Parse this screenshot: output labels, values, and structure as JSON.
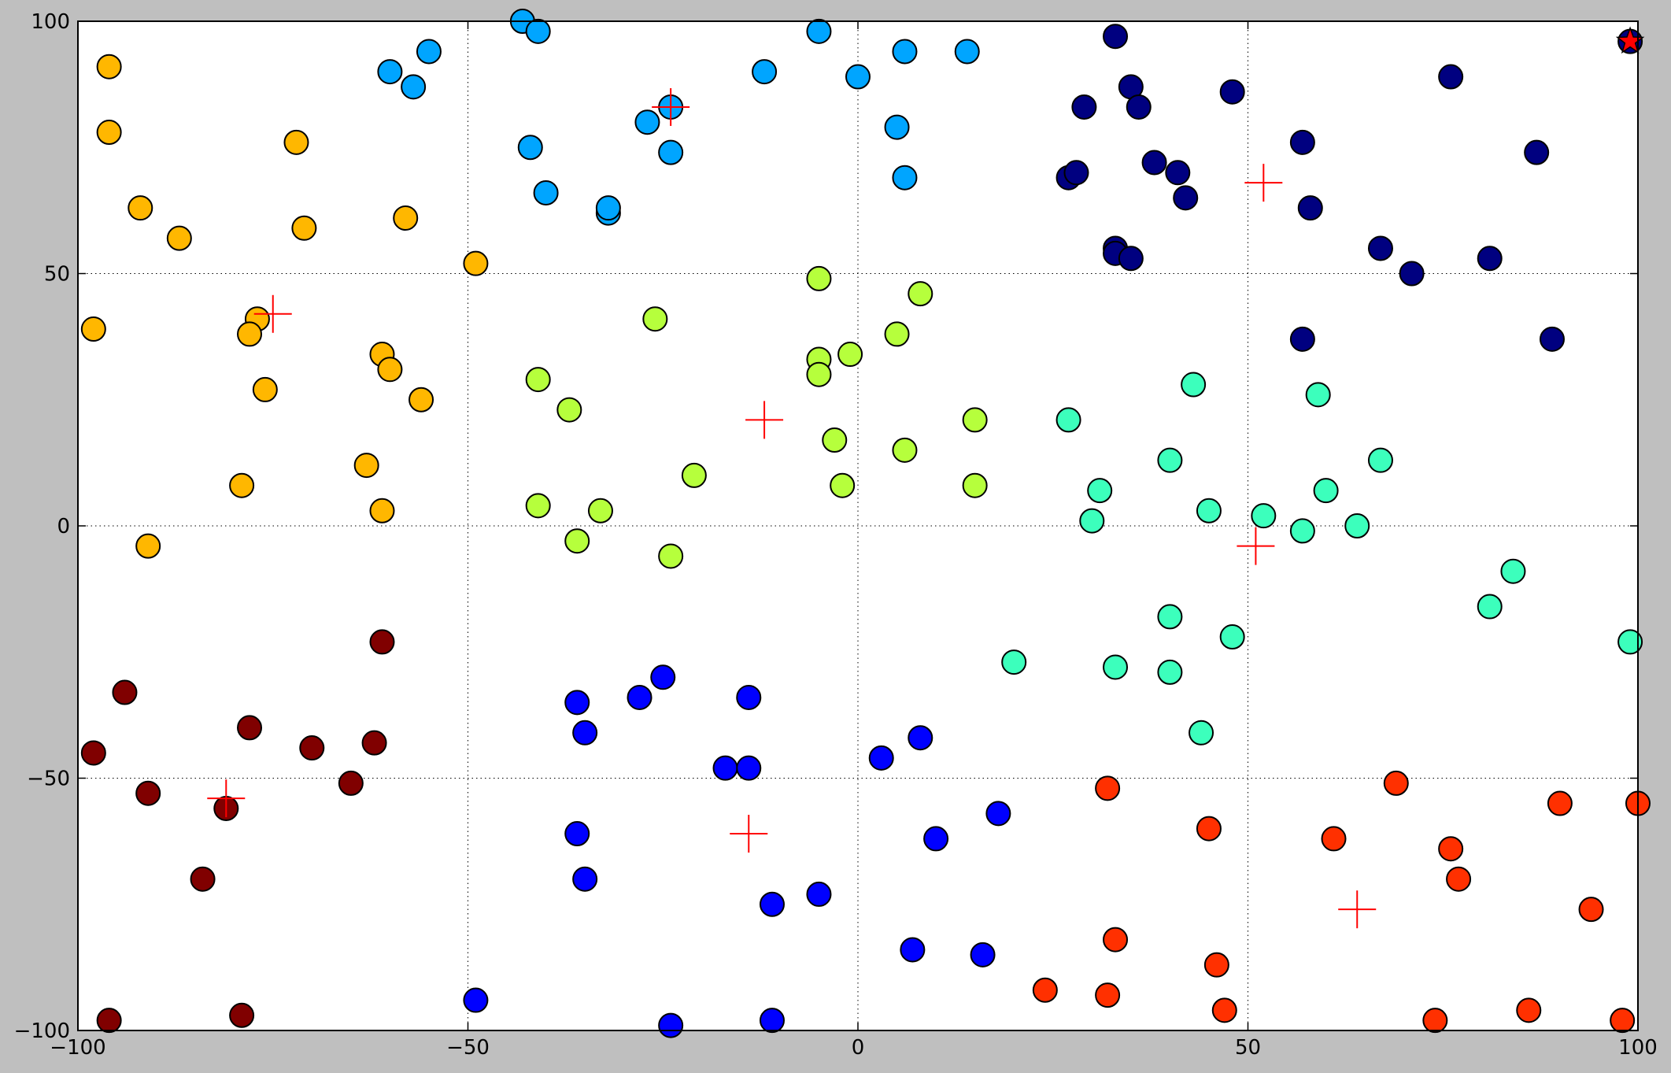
{
  "colors": {
    "figure_background": "#bfbfbf",
    "plot_background": "#ffffff",
    "marker_edge": "#000000",
    "centroid_marker": "#ff0000",
    "highlight_star": "#ff0000"
  },
  "chart_data": {
    "type": "scatter",
    "title": "",
    "xlabel": "",
    "ylabel": "",
    "xlim": [
      -100,
      100
    ],
    "ylim": [
      -100,
      100
    ],
    "xticks": [
      -100,
      -50,
      0,
      50,
      100
    ],
    "yticks": [
      -100,
      -50,
      0,
      50,
      100
    ],
    "grid": true,
    "grid_style": "dotted",
    "legend": "none",
    "colormap": "jet",
    "centroid_marker": "plus",
    "series": [
      {
        "color": "#000080",
        "points": [
          [
            33,
            97
          ],
          [
            76,
            89
          ],
          [
            48,
            86
          ],
          [
            29,
            83
          ],
          [
            35,
            87
          ],
          [
            36,
            83
          ],
          [
            57,
            76
          ],
          [
            87,
            74
          ],
          [
            38,
            72
          ],
          [
            41,
            70
          ],
          [
            27,
            69
          ],
          [
            28,
            70
          ],
          [
            42,
            65
          ],
          [
            58,
            63
          ],
          [
            33,
            55
          ],
          [
            33,
            54
          ],
          [
            35,
            53
          ],
          [
            67,
            55
          ],
          [
            71,
            50
          ],
          [
            81,
            53
          ],
          [
            89,
            37
          ],
          [
            57,
            37
          ]
        ]
      },
      {
        "color": "#0000ff",
        "points": [
          [
            -36,
            -35
          ],
          [
            -28,
            -34
          ],
          [
            -25,
            -30
          ],
          [
            -14,
            -34
          ],
          [
            -35,
            -41
          ],
          [
            -17,
            -48
          ],
          [
            -14,
            -48
          ],
          [
            3,
            -46
          ],
          [
            8,
            -42
          ],
          [
            18,
            -57
          ],
          [
            -36,
            -61
          ],
          [
            -35,
            -70
          ],
          [
            10,
            -62
          ],
          [
            -11,
            -75
          ],
          [
            -5,
            -73
          ],
          [
            7,
            -84
          ],
          [
            16,
            -85
          ],
          [
            -49,
            -94
          ],
          [
            -24,
            -99
          ],
          [
            -11,
            -98
          ]
        ]
      },
      {
        "color": "#00a5ff",
        "points": [
          [
            -43,
            100
          ],
          [
            -41,
            98
          ],
          [
            -60,
            90
          ],
          [
            -55,
            94
          ],
          [
            -57,
            87
          ],
          [
            -5,
            98
          ],
          [
            6,
            94
          ],
          [
            14,
            94
          ],
          [
            -12,
            90
          ],
          [
            0,
            89
          ],
          [
            -27,
            80
          ],
          [
            -24,
            83
          ],
          [
            -24,
            74
          ],
          [
            -42,
            75
          ],
          [
            -40,
            66
          ],
          [
            -32,
            62
          ],
          [
            -32,
            63
          ],
          [
            5,
            79
          ],
          [
            6,
            69
          ]
        ]
      },
      {
        "color": "#3cffbc",
        "points": [
          [
            43,
            28
          ],
          [
            59,
            26
          ],
          [
            27,
            21
          ],
          [
            40,
            13
          ],
          [
            31,
            7
          ],
          [
            60,
            7
          ],
          [
            67,
            13
          ],
          [
            30,
            1
          ],
          [
            45,
            3
          ],
          [
            52,
            2
          ],
          [
            57,
            -1
          ],
          [
            64,
            0
          ],
          [
            84,
            -9
          ],
          [
            40,
            -18
          ],
          [
            81,
            -16
          ],
          [
            48,
            -22
          ],
          [
            99,
            -23
          ],
          [
            20,
            -27
          ],
          [
            33,
            -28
          ],
          [
            40,
            -29
          ],
          [
            44,
            -41
          ]
        ]
      },
      {
        "color": "#b6ff3c",
        "points": [
          [
            -5,
            49
          ],
          [
            8,
            46
          ],
          [
            -26,
            41
          ],
          [
            5,
            38
          ],
          [
            -5,
            33
          ],
          [
            -1,
            34
          ],
          [
            -41,
            29
          ],
          [
            -5,
            30
          ],
          [
            -37,
            23
          ],
          [
            15,
            21
          ],
          [
            -3,
            17
          ],
          [
            6,
            15
          ],
          [
            -21,
            10
          ],
          [
            -2,
            8
          ],
          [
            15,
            8
          ],
          [
            -41,
            4
          ],
          [
            -33,
            3
          ],
          [
            -36,
            -3
          ],
          [
            -24,
            -6
          ]
        ]
      },
      {
        "color": "#ffb700",
        "points": [
          [
            -96,
            91
          ],
          [
            -96,
            78
          ],
          [
            -72,
            76
          ],
          [
            -92,
            63
          ],
          [
            -87,
            57
          ],
          [
            -71,
            59
          ],
          [
            -58,
            61
          ],
          [
            -49,
            52
          ],
          [
            -98,
            39
          ],
          [
            -77,
            41
          ],
          [
            -78,
            38
          ],
          [
            -61,
            34
          ],
          [
            -60,
            31
          ],
          [
            -76,
            27
          ],
          [
            -56,
            25
          ],
          [
            -63,
            12
          ],
          [
            -79,
            8
          ],
          [
            -61,
            3
          ],
          [
            -91,
            -4
          ]
        ]
      },
      {
        "color": "#ff3000",
        "points": [
          [
            32,
            -52
          ],
          [
            69,
            -51
          ],
          [
            45,
            -60
          ],
          [
            61,
            -62
          ],
          [
            76,
            -64
          ],
          [
            77,
            -70
          ],
          [
            90,
            -55
          ],
          [
            100,
            -55
          ],
          [
            94,
            -76
          ],
          [
            33,
            -82
          ],
          [
            46,
            -87
          ],
          [
            24,
            -92
          ],
          [
            32,
            -93
          ],
          [
            47,
            -96
          ],
          [
            74,
            -98
          ],
          [
            86,
            -96
          ],
          [
            98,
            -98
          ]
        ]
      },
      {
        "color": "#800000",
        "points": [
          [
            -61,
            -23
          ],
          [
            -94,
            -33
          ],
          [
            -78,
            -40
          ],
          [
            -70,
            -44
          ],
          [
            -62,
            -43
          ],
          [
            -98,
            -45
          ],
          [
            -91,
            -53
          ],
          [
            -81,
            -56
          ],
          [
            -65,
            -51
          ],
          [
            -84,
            -70
          ],
          [
            -79,
            -97
          ],
          [
            -96,
            -98
          ]
        ]
      }
    ],
    "centroids": [
      [
        -24,
        83
      ],
      [
        52,
        68
      ],
      [
        -75,
        42
      ],
      [
        -12,
        21
      ],
      [
        51,
        -4
      ],
      [
        -81,
        -54
      ],
      [
        -14,
        -61
      ],
      [
        64,
        -76
      ]
    ],
    "highlight_point": [
      99,
      96
    ]
  }
}
